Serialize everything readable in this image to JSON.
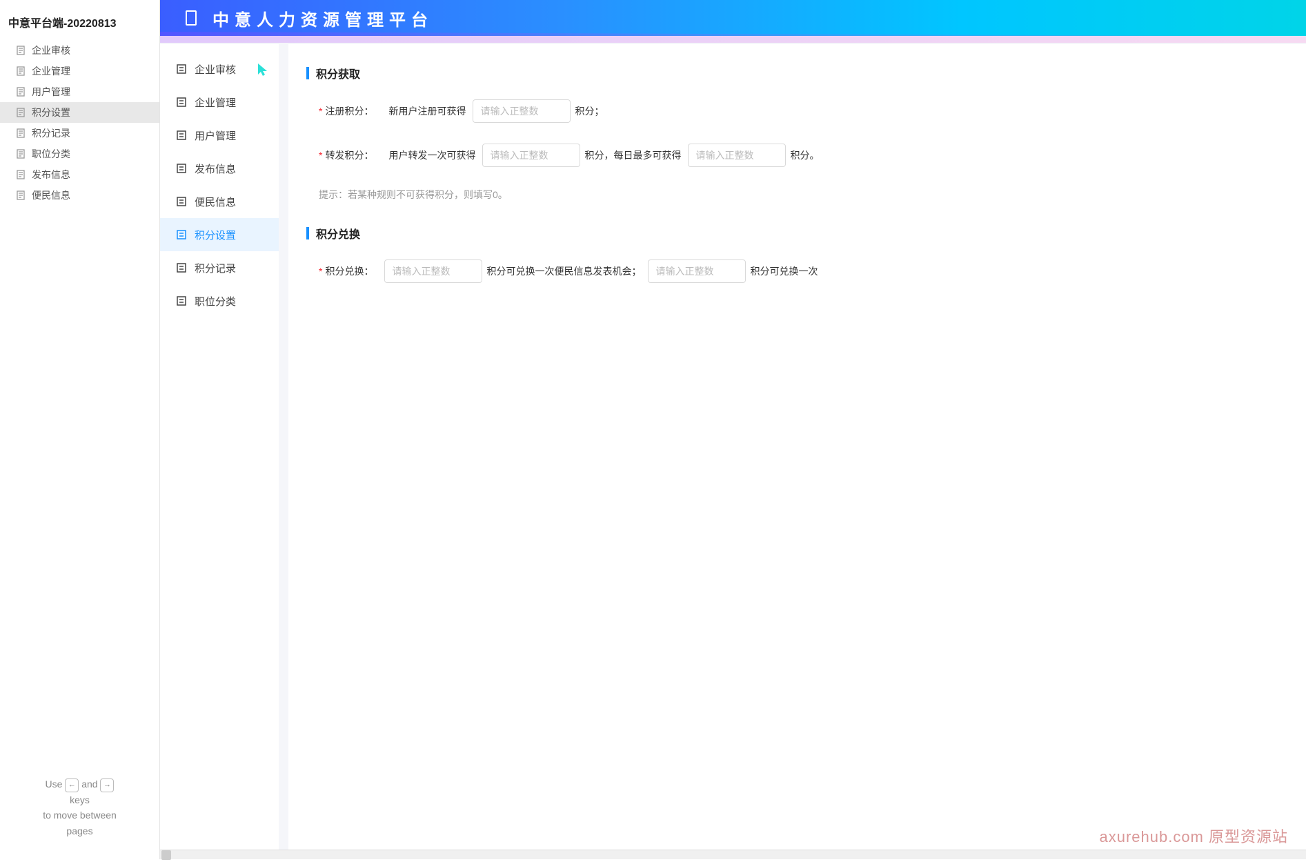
{
  "outline": {
    "title": "中意平台端-20220813",
    "items": [
      {
        "label": "企业审核",
        "active": false
      },
      {
        "label": "企业管理",
        "active": false
      },
      {
        "label": "用户管理",
        "active": false
      },
      {
        "label": "积分设置",
        "active": true
      },
      {
        "label": "积分记录",
        "active": false
      },
      {
        "label": "职位分类",
        "active": false
      },
      {
        "label": "发布信息",
        "active": false
      },
      {
        "label": "便民信息",
        "active": false
      }
    ],
    "hint": {
      "use": "Use",
      "and": "and",
      "keys": "keys",
      "move": "to move between",
      "pages": "pages",
      "left_key": "←",
      "right_key": "→"
    }
  },
  "banner": {
    "title": "中意人力资源管理平台"
  },
  "nav": {
    "items": [
      {
        "label": "企业审核",
        "active": false,
        "cursor": true
      },
      {
        "label": "企业管理",
        "active": false
      },
      {
        "label": "用户管理",
        "active": false
      },
      {
        "label": "发布信息",
        "active": false
      },
      {
        "label": "便民信息",
        "active": false
      },
      {
        "label": "积分设置",
        "active": true
      },
      {
        "label": "积分记录",
        "active": false
      },
      {
        "label": "职位分类",
        "active": false
      }
    ]
  },
  "content": {
    "section1_title": "积分获取",
    "row_register": {
      "label": "注册积分：",
      "text_before": "新用户注册可获得",
      "placeholder": "请输入正整数",
      "text_after": "积分；"
    },
    "row_forward": {
      "label": "转发积分：",
      "text_before": "用户转发一次可获得",
      "placeholder1": "请输入正整数",
      "text_mid": "积分，每日最多可获得",
      "placeholder2": "请输入正整数",
      "text_after": "积分。"
    },
    "hint": "提示：若某种规则不可获得积分，则填写0。",
    "section2_title": "积分兑换",
    "row_exchange": {
      "label": "积分兑换：",
      "placeholder1": "请输入正整数",
      "text_mid": "积分可兑换一次便民信息发表机会；",
      "placeholder2": "请输入正整数",
      "text_after": "积分可兑换一次"
    }
  },
  "watermark": "axurehub.com 原型资源站"
}
